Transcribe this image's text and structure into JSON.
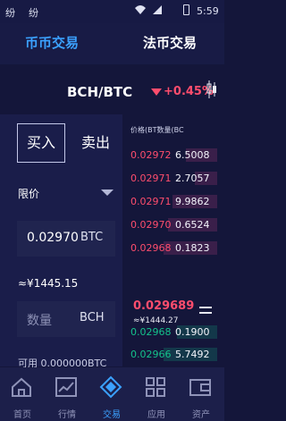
{
  "status_bar": {
    "left_text": "纷",
    "left_text2": "纷",
    "time": "5:59",
    "colors": {
      "bg": "#171a44",
      "text": "#dfe2f2"
    }
  },
  "tabs": [
    {
      "label": "币币交易",
      "active": true
    },
    {
      "label": "法币交易",
      "active": false
    }
  ],
  "pair": {
    "symbol": "BCH/BTC",
    "change": "+0.45%"
  },
  "trade": {
    "buy_label": "买入",
    "sell_label": "卖出",
    "order_type": "限价",
    "price_value": "0.02970",
    "price_unit": "BTC",
    "approx_cny": "≈¥1445.15",
    "qty_placeholder": "数量",
    "qty_unit": "BCH",
    "available": "可用 0.000000BTC"
  },
  "orderbook": {
    "header": "价格(BT数量(BC",
    "asks": [
      {
        "price": "0.02972",
        "qty": "6.5008",
        "depth": 0.35
      },
      {
        "price": "0.02971",
        "qty": "2.7057",
        "depth": 0.25
      },
      {
        "price": "0.02971",
        "qty": "9.9862",
        "depth": 0.5
      },
      {
        "price": "0.02970",
        "qty": "0.6524",
        "depth": 0.55
      },
      {
        "price": "0.02968",
        "qty": "0.1823",
        "depth": 0.6
      }
    ],
    "mid_price": "0.029689",
    "mid_cny": "≈¥1444.27",
    "bids": [
      {
        "price": "0.02968",
        "qty": "0.1900",
        "depth": 0.45
      },
      {
        "price": "0.02966",
        "qty": "5.7492",
        "depth": 0.6
      }
    ]
  },
  "nav": [
    {
      "label": "首页",
      "icon": "home-icon",
      "active": false
    },
    {
      "label": "行情",
      "icon": "chart-icon",
      "active": false
    },
    {
      "label": "交易",
      "icon": "exchange-icon",
      "active": true
    },
    {
      "label": "应用",
      "icon": "grid-icon",
      "active": false
    },
    {
      "label": "资产",
      "icon": "wallet-icon",
      "active": false
    }
  ],
  "colors": {
    "accent": "#3ba1ff",
    "red": "#ff4d6d",
    "green": "#14c28b",
    "bg": "#14163a"
  }
}
